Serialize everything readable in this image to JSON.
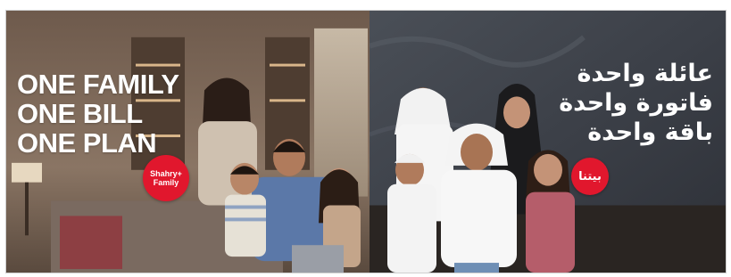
{
  "left_ad": {
    "headline_lines": [
      "ONE FAMILY",
      "ONE BILL",
      "ONE PLAN"
    ],
    "badge": {
      "line1": "Shahry+",
      "line2": "Family",
      "color": "#e1172d"
    }
  },
  "right_ad": {
    "headline_lines": [
      "عائلة واحدة",
      "فاتورة واحدة",
      "باقة واحدة"
    ],
    "badge": {
      "label": "بيتنا",
      "color": "#e1172d"
    }
  }
}
